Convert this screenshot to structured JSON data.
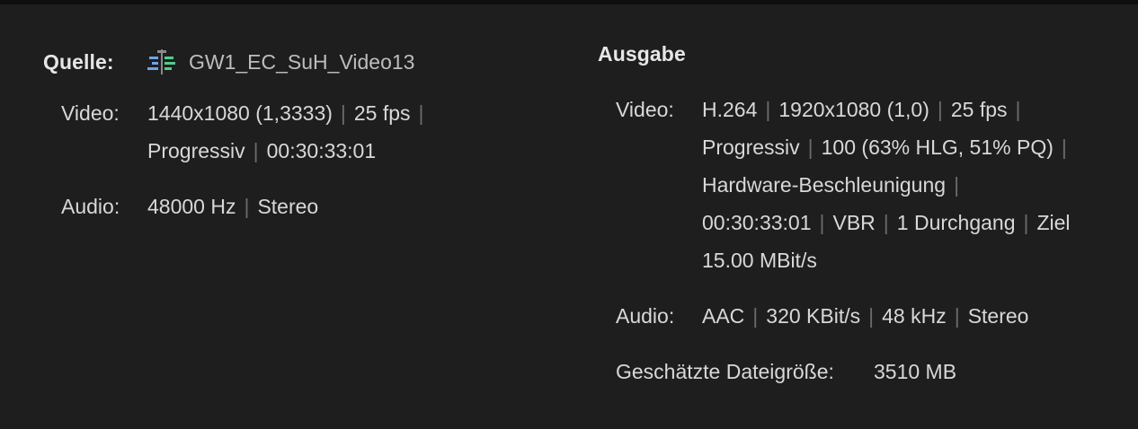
{
  "source": {
    "heading": "Quelle:",
    "sequence_name": "GW1_EC_SuH_Video13",
    "sequence_icon": "sequence-icon",
    "video_label": "Video:",
    "video": {
      "resolution": "1440x1080 (1,3333)",
      "fps": "25 fps",
      "scan": "Progressiv",
      "duration": "00:30:33:01"
    },
    "audio_label": "Audio:",
    "audio": {
      "rate": "48000 Hz",
      "channels": "Stereo"
    }
  },
  "output": {
    "heading": "Ausgabe",
    "video_label": "Video:",
    "video": {
      "codec": "H.264",
      "resolution": "1920x1080 (1,0)",
      "fps": "25 fps",
      "scan": "Progressiv",
      "quality": "100 (63% HLG, 51% PQ)",
      "acceleration": "Hardware-Beschleunigung",
      "duration": "00:30:33:01",
      "bitrate_mode": "VBR",
      "passes": "1 Durchgang",
      "target_word": "Ziel",
      "target_rate": "15.00 MBit/s"
    },
    "audio_label": "Audio:",
    "audio": {
      "codec": "AAC",
      "bitrate": "320 KBit/s",
      "rate": "48 kHz",
      "channels": "Stereo"
    },
    "filesize_label": "Geschätzte Dateigröße:",
    "filesize_value": "3510 MB"
  },
  "separator": "|",
  "colors": {
    "background": "#1e1e1e",
    "text": "#d8d8d8",
    "separator": "#6a6a6a",
    "icon_blue": "#6fa3e8",
    "icon_green": "#4fcf8a"
  }
}
